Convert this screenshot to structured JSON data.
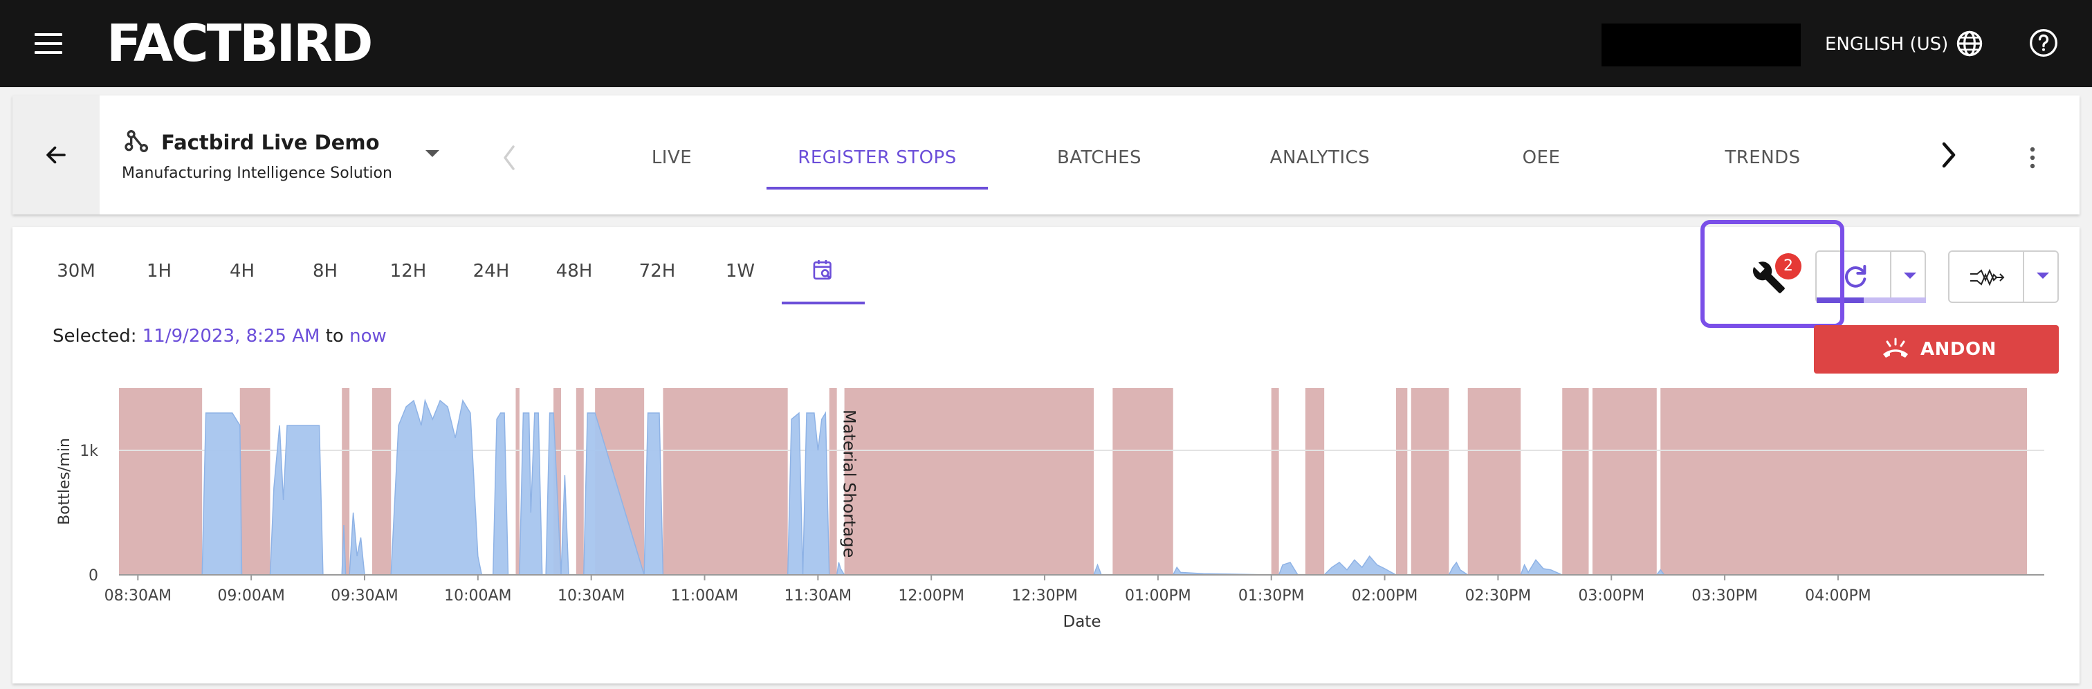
{
  "app": {
    "brand": "FACTBIRD",
    "language": "ENGLISH (US)"
  },
  "header": {
    "site_name": "Factbird Live Demo",
    "site_subtitle": "Manufacturing Intelligence Solution",
    "tabs": [
      {
        "label": "LIVE",
        "active": false
      },
      {
        "label": "REGISTER STOPS",
        "active": true
      },
      {
        "label": "BATCHES",
        "active": false
      },
      {
        "label": "ANALYTICS",
        "active": false
      },
      {
        "label": "OEE",
        "active": false
      },
      {
        "label": "TRENDS",
        "active": false
      }
    ]
  },
  "toolbar": {
    "ranges": [
      "30M",
      "1H",
      "4H",
      "8H",
      "12H",
      "24H",
      "48H",
      "72H",
      "1W"
    ],
    "active_range": "custom-calendar",
    "selected_prefix": "Selected:",
    "selected_from": "11/9/2023, 8:25 AM",
    "selected_to_word": "to",
    "selected_to": "now",
    "maintenance_badge": "2",
    "refresh_progress": 0.43,
    "andon_label": "ANDON"
  },
  "colors": {
    "accent": "#6b4ed9",
    "stop": "#dcb4b4",
    "production": "#a7c5ee",
    "andon": "#dd4444",
    "badge": "#e53935"
  },
  "chart_data": {
    "type": "area",
    "ylabel": "Bottles/min",
    "xlabel": "Date",
    "yticks": [
      "0",
      "1k"
    ],
    "ylim": [
      0,
      1500
    ],
    "xlim": [
      "08:25",
      "16:50"
    ],
    "xticks": [
      "08:30AM",
      "09:00AM",
      "09:30AM",
      "10:00AM",
      "10:30AM",
      "11:00AM",
      "11:30AM",
      "12:00PM",
      "12:30PM",
      "01:00PM",
      "01:30PM",
      "02:00PM",
      "02:30PM",
      "03:00PM",
      "03:30PM",
      "04:00PM"
    ],
    "annotation": "Material Shortage",
    "stops": [
      [
        "08:25",
        "08:47"
      ],
      [
        "08:57",
        "09:05"
      ],
      [
        "09:24",
        "09:26"
      ],
      [
        "09:32",
        "09:37"
      ],
      [
        "10:10",
        "10:11"
      ],
      [
        "10:20",
        "10:22"
      ],
      [
        "10:26",
        "10:28"
      ],
      [
        "10:31",
        "10:44"
      ],
      [
        "10:49",
        "11:22"
      ],
      [
        "11:33",
        "11:35"
      ],
      [
        "11:37",
        "12:43"
      ],
      [
        "12:48",
        "13:04"
      ],
      [
        "13:30",
        "13:32"
      ],
      [
        "13:39",
        "13:44"
      ],
      [
        "14:03",
        "14:06"
      ],
      [
        "14:07",
        "14:17"
      ],
      [
        "14:22",
        "14:36"
      ],
      [
        "14:47",
        "14:54"
      ],
      [
        "14:55",
        "15:12"
      ],
      [
        "15:13",
        "16:50"
      ]
    ],
    "series": [
      {
        "values": [
          [
            "08:25",
            0
          ],
          [
            "08:47",
            0
          ],
          [
            "08:48",
            1300
          ],
          [
            "08:55",
            1300
          ],
          [
            "08:57",
            1200
          ],
          [
            "08:57.5",
            0
          ],
          [
            "09:05",
            0
          ],
          [
            "09:06",
            700
          ],
          [
            "09:07.5",
            1200
          ],
          [
            "09:08.5",
            600
          ],
          [
            "09:09.5",
            1200
          ],
          [
            "09:18",
            1200
          ],
          [
            "09:19",
            0
          ],
          [
            "09:24",
            0
          ],
          [
            "09:24.5",
            400
          ],
          [
            "09:25",
            0
          ],
          [
            "09:26",
            0
          ],
          [
            "09:27",
            500
          ],
          [
            "09:28",
            150
          ],
          [
            "09:29",
            300
          ],
          [
            "09:30",
            0
          ],
          [
            "09:37",
            0
          ],
          [
            "09:39",
            1200
          ],
          [
            "09:41",
            1350
          ],
          [
            "09:43",
            1400
          ],
          [
            "09:45",
            1200
          ],
          [
            "09:46",
            1400
          ],
          [
            "09:48",
            1250
          ],
          [
            "09:50",
            1400
          ],
          [
            "09:52",
            1350
          ],
          [
            "09:54",
            1100
          ],
          [
            "09:56",
            1400
          ],
          [
            "09:58",
            1300
          ],
          [
            "10:00",
            150
          ],
          [
            "10:01",
            0
          ],
          [
            "10:04",
            0
          ],
          [
            "10:05",
            1250
          ],
          [
            "10:06",
            1300
          ],
          [
            "10:07",
            1300
          ],
          [
            "10:08",
            0
          ],
          [
            "10:11",
            0
          ],
          [
            "10:12",
            1300
          ],
          [
            "10:13.5",
            1300
          ],
          [
            "10:14",
            500
          ],
          [
            "10:15",
            1300
          ],
          [
            "10:16",
            1300
          ],
          [
            "10:17",
            0
          ],
          [
            "10:18",
            0
          ],
          [
            "10:19",
            1300
          ],
          [
            "10:20",
            1300
          ],
          [
            "10:22",
            0
          ],
          [
            "10:23",
            800
          ],
          [
            "10:24",
            0
          ],
          [
            "10:28",
            0
          ],
          [
            "10:29",
            1300
          ],
          [
            "10:31",
            1300
          ],
          [
            "10:44",
            0
          ],
          [
            "10:45",
            1300
          ],
          [
            "10:48",
            1300
          ],
          [
            "10:49",
            0
          ],
          [
            "11:22",
            0
          ],
          [
            "11:23",
            1250
          ],
          [
            "11:25",
            1300
          ],
          [
            "11:26",
            0
          ],
          [
            "11:27",
            1300
          ],
          [
            "11:29",
            1300
          ],
          [
            "11:30",
            1000
          ],
          [
            "11:31",
            1250
          ],
          [
            "11:32",
            1300
          ],
          [
            "11:33",
            0
          ],
          [
            "11:35",
            0
          ],
          [
            "11:35.5",
            100
          ],
          [
            "11:36",
            50
          ],
          [
            "11:37",
            0
          ],
          [
            "12:43",
            0
          ],
          [
            "12:44",
            80
          ],
          [
            "12:45",
            0
          ],
          [
            "13:04",
            0
          ],
          [
            "13:05",
            60
          ],
          [
            "13:06",
            20
          ],
          [
            "13:12",
            10
          ],
          [
            "13:30",
            0
          ],
          [
            "13:32",
            0
          ],
          [
            "13:33",
            80
          ],
          [
            "13:35",
            100
          ],
          [
            "13:37",
            0
          ],
          [
            "13:44",
            0
          ],
          [
            "13:46",
            60
          ],
          [
            "13:48",
            100
          ],
          [
            "13:50",
            40
          ],
          [
            "13:52",
            120
          ],
          [
            "13:54",
            60
          ],
          [
            "13:56",
            150
          ],
          [
            "13:58",
            80
          ],
          [
            "14:00",
            50
          ],
          [
            "14:03",
            0
          ],
          [
            "14:17",
            0
          ],
          [
            "14:18",
            60
          ],
          [
            "14:19",
            100
          ],
          [
            "14:20",
            40
          ],
          [
            "14:22",
            0
          ],
          [
            "14:36",
            0
          ],
          [
            "14:37",
            80
          ],
          [
            "14:38",
            20
          ],
          [
            "14:40",
            120
          ],
          [
            "14:42",
            50
          ],
          [
            "14:44",
            40
          ],
          [
            "14:47",
            0
          ],
          [
            "15:12",
            0
          ],
          [
            "15:13",
            40
          ],
          [
            "15:14",
            0
          ],
          [
            "16:50",
            0
          ]
        ]
      }
    ]
  }
}
